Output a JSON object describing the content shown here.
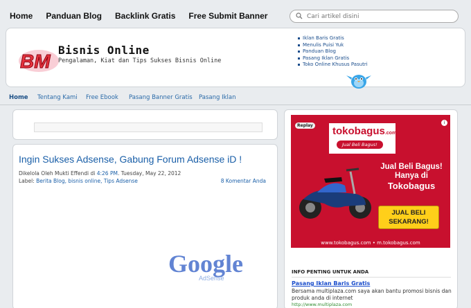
{
  "topnav": {
    "links": [
      "Home",
      "Panduan Blog",
      "Backlink Gratis",
      "Free Submit Banner"
    ],
    "search_placeholder": "Cari artikel disini"
  },
  "header": {
    "logo_text": "BM",
    "title": "Bisnis Online",
    "description": "Pengalaman, Kiat dan Tips Sukses Bisnis Online",
    "links": [
      "Iklan Baris Gratis",
      "Menulis Puisi Yuk",
      "Panduan Blog",
      "Pasang Iklan Gratis",
      "Toko Online Khusus Pasutri"
    ]
  },
  "subnav": {
    "items": [
      "Home",
      "Tentang Kami",
      "Free Ebook",
      "Pasang Banner Gratis",
      "Pasang Iklan"
    ]
  },
  "post": {
    "title": "Ingin Sukses Adsense, Gabung Forum Adsense iD !",
    "meta_prefix": "Dikelola Oleh Mukti Effendi di ",
    "time": "4:26 PM",
    "date": ". Tuesday, May 22, 2012",
    "labels_prefix": "Label: ",
    "labels": "Berita Blog, bisnis online, Tips Adsense",
    "comments": "8 Komentar Anda",
    "image_logo": "Google",
    "image_sub": "AdSense"
  },
  "ad": {
    "replay": "Replay",
    "info": "i",
    "brand": "tokobagus",
    "brand_suffix": ".com",
    "tagline": "Jual Beli Bagus!",
    "headline": "Jual Beli Bagus! Hanya di",
    "big": "Tokobagus",
    "cta": "JUAL BELI SEKARANG!",
    "urls": "www.tokobagus.com   •   m.tokobagus.com",
    "colors": {
      "bg": "#c8102e",
      "cta": "#ffcf1a"
    }
  },
  "sidebar": {
    "heading": "INFO PENTING UNTUK ANDA",
    "link": "Pasang Iklan Baris Gratis",
    "text": "Bersama multiplaza.com saya akan bantu promosi bisnis dan produk anda di internet",
    "url": "http://www.multiplaza.com"
  }
}
